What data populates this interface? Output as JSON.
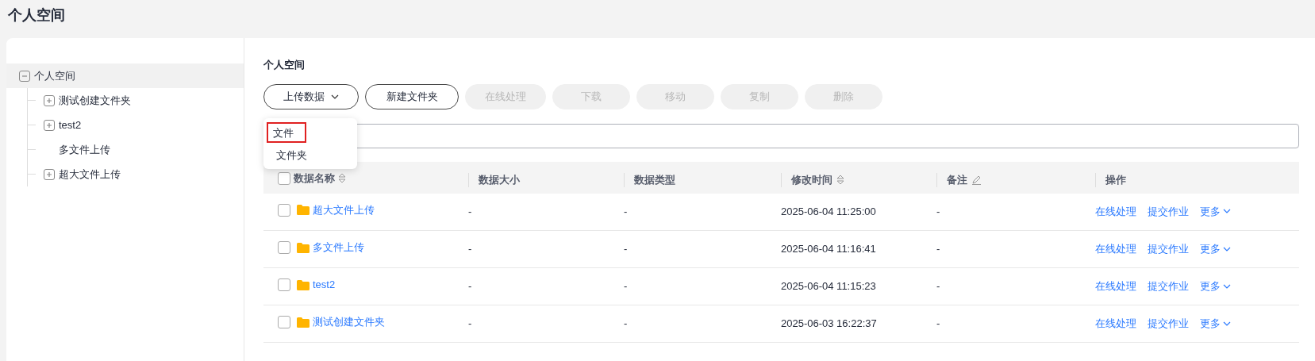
{
  "page_title": "个人空间",
  "tree": {
    "label": "个人空间",
    "kind": "folder",
    "expanded": true,
    "selected": true,
    "children": [
      {
        "label": "测试创建文件夹",
        "kind": "folder",
        "expanded": false,
        "selected": false
      },
      {
        "label": "test2",
        "kind": "folder",
        "expanded": false,
        "selected": false
      },
      {
        "label": "多文件上传",
        "kind": "leaf",
        "selected": false
      },
      {
        "label": "超大文件上传",
        "kind": "folder",
        "expanded": false,
        "selected": false
      }
    ]
  },
  "section_title": "个人空间",
  "toolbar": [
    {
      "label": "上传数据",
      "disabled": false,
      "kind": "dropdown"
    },
    {
      "label": "新建文件夹",
      "disabled": false,
      "kind": "button"
    },
    {
      "label": "在线处理",
      "disabled": true,
      "kind": "button"
    },
    {
      "label": "下载",
      "disabled": true,
      "kind": "button"
    },
    {
      "label": "移动",
      "disabled": true,
      "kind": "button"
    },
    {
      "label": "复制",
      "disabled": true,
      "kind": "button"
    },
    {
      "label": "删除",
      "disabled": true,
      "kind": "button"
    }
  ],
  "upload_menu": [
    {
      "label": "文件",
      "selected": true
    },
    {
      "label": "文件夹",
      "selected": false
    }
  ],
  "table": {
    "select_all_checked": false,
    "columns": [
      {
        "label": "数据名称",
        "kind": "sortable"
      },
      {
        "label": "数据大小",
        "kind": "plain"
      },
      {
        "label": "数据类型",
        "kind": "plain"
      },
      {
        "label": "修改时间",
        "kind": "sortable"
      },
      {
        "label": "备注",
        "kind": "editable"
      },
      {
        "label": "操作",
        "kind": "plain"
      }
    ],
    "rows": [
      {
        "checked": false,
        "name": "超大文件上传",
        "size": "-",
        "type": "-",
        "modified": "2025-06-04 11:25:00",
        "note": "-",
        "actions": [
          "在线处理",
          "提交作业",
          "更多"
        ]
      },
      {
        "checked": false,
        "name": "多文件上传",
        "size": "-",
        "type": "-",
        "modified": "2025-06-04 11:16:41",
        "note": "-",
        "actions": [
          "在线处理",
          "提交作业",
          "更多"
        ]
      },
      {
        "checked": false,
        "name": "test2",
        "size": "-",
        "type": "-",
        "modified": "2025-06-04 11:15:23",
        "note": "-",
        "actions": [
          "在线处理",
          "提交作业",
          "更多"
        ]
      },
      {
        "checked": false,
        "name": "测试创建文件夹",
        "size": "-",
        "type": "-",
        "modified": "2025-06-03 16:22:37",
        "note": "-",
        "actions": [
          "在线处理",
          "提交作业",
          "更多"
        ]
      }
    ]
  }
}
